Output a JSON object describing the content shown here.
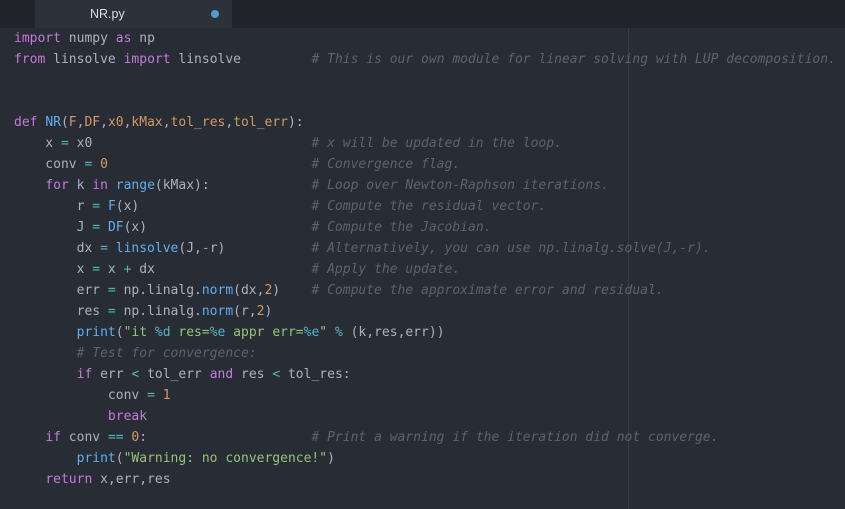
{
  "tab": {
    "title": "NR.py",
    "modified_indicator": "modified-dot"
  },
  "colors": {
    "background": "#282c34",
    "tab_bar": "#21252b",
    "tab_active": "#2c313a",
    "text": "#abb2bf",
    "keyword": "#c678dd",
    "function": "#61afef",
    "string": "#98c379",
    "comment": "#5c6370",
    "number": "#d19a66",
    "operator": "#56b6c2",
    "param": "#d19a66",
    "modified_dot": "#529cca",
    "ruler": "#383e49"
  },
  "editor": {
    "lines": [
      [
        [
          "import",
          "kw"
        ],
        [
          " numpy ",
          "txt"
        ],
        [
          "as",
          "kw"
        ],
        [
          " np",
          "txt"
        ]
      ],
      [
        [
          "from",
          "kw"
        ],
        [
          " linsolve ",
          "txt"
        ],
        [
          "import",
          "kw"
        ],
        [
          " linsolve",
          "txt"
        ],
        [
          "         ",
          "txt"
        ],
        [
          "# This is our own module for linear solving with LUP decomposition.",
          "cmt"
        ]
      ],
      [],
      [],
      [
        [
          "def",
          "kw"
        ],
        [
          " ",
          "txt"
        ],
        [
          "NR",
          "fn"
        ],
        [
          "(",
          "txt"
        ],
        [
          "F",
          "param"
        ],
        [
          ",",
          "txt"
        ],
        [
          "DF",
          "param"
        ],
        [
          ",",
          "txt"
        ],
        [
          "x0",
          "param"
        ],
        [
          ",",
          "txt"
        ],
        [
          "kMax",
          "param"
        ],
        [
          ",",
          "txt"
        ],
        [
          "tol_res",
          "param"
        ],
        [
          ",",
          "txt"
        ],
        [
          "tol_err",
          "param"
        ],
        [
          "):",
          "txt"
        ]
      ],
      [
        [
          "    x ",
          "txt"
        ],
        [
          "=",
          "op"
        ],
        [
          " x0",
          "txt"
        ],
        [
          "                            ",
          "txt"
        ],
        [
          "# x will be updated in the loop.",
          "cmt"
        ]
      ],
      [
        [
          "    conv ",
          "txt"
        ],
        [
          "=",
          "op"
        ],
        [
          " ",
          "txt"
        ],
        [
          "0",
          "num"
        ],
        [
          "                          ",
          "txt"
        ],
        [
          "# Convergence flag.",
          "cmt"
        ]
      ],
      [
        [
          "    ",
          "txt"
        ],
        [
          "for",
          "kw"
        ],
        [
          " k ",
          "txt"
        ],
        [
          "in",
          "kw"
        ],
        [
          " ",
          "txt"
        ],
        [
          "range",
          "fn"
        ],
        [
          "(kMax):",
          "txt"
        ],
        [
          "             ",
          "txt"
        ],
        [
          "# Loop over Newton-Raphson iterations.",
          "cmt"
        ]
      ],
      [
        [
          "        r ",
          "txt"
        ],
        [
          "=",
          "op"
        ],
        [
          " ",
          "txt"
        ],
        [
          "F",
          "fn"
        ],
        [
          "(x)",
          "txt"
        ],
        [
          "                      ",
          "txt"
        ],
        [
          "# Compute the residual vector.",
          "cmt"
        ]
      ],
      [
        [
          "        J ",
          "txt"
        ],
        [
          "=",
          "op"
        ],
        [
          " ",
          "txt"
        ],
        [
          "DF",
          "fn"
        ],
        [
          "(x)",
          "txt"
        ],
        [
          "                     ",
          "txt"
        ],
        [
          "# Compute the Jacobian.",
          "cmt"
        ]
      ],
      [
        [
          "        dx ",
          "txt"
        ],
        [
          "=",
          "op"
        ],
        [
          " ",
          "txt"
        ],
        [
          "linsolve",
          "fn"
        ],
        [
          "(J,",
          "txt"
        ],
        [
          "-",
          "op"
        ],
        [
          "r)",
          "txt"
        ],
        [
          "           ",
          "txt"
        ],
        [
          "# Alternatively, you can use np.linalg.solve(J,-r).",
          "cmt"
        ]
      ],
      [
        [
          "        x ",
          "txt"
        ],
        [
          "=",
          "op"
        ],
        [
          " x ",
          "txt"
        ],
        [
          "+",
          "op"
        ],
        [
          " dx",
          "txt"
        ],
        [
          "                    ",
          "txt"
        ],
        [
          "# Apply the update.",
          "cmt"
        ]
      ],
      [
        [
          "        err ",
          "txt"
        ],
        [
          "=",
          "op"
        ],
        [
          " np.linalg.",
          "txt"
        ],
        [
          "norm",
          "fn"
        ],
        [
          "(dx,",
          "txt"
        ],
        [
          "2",
          "num"
        ],
        [
          ")",
          "txt"
        ],
        [
          "    ",
          "txt"
        ],
        [
          "# Compute the approximate error and residual.",
          "cmt"
        ]
      ],
      [
        [
          "        res ",
          "txt"
        ],
        [
          "=",
          "op"
        ],
        [
          " np.linalg.",
          "txt"
        ],
        [
          "norm",
          "fn"
        ],
        [
          "(r,",
          "txt"
        ],
        [
          "2",
          "num"
        ],
        [
          ")",
          "txt"
        ]
      ],
      [
        [
          "        ",
          "txt"
        ],
        [
          "print",
          "fn"
        ],
        [
          "(",
          "txt"
        ],
        [
          "\"it ",
          "str"
        ],
        [
          "%d",
          "fmt"
        ],
        [
          " res=",
          "str"
        ],
        [
          "%e",
          "fmt"
        ],
        [
          " appr err=",
          "str"
        ],
        [
          "%e",
          "fmt"
        ],
        [
          "\"",
          "str"
        ],
        [
          " ",
          "txt"
        ],
        [
          "%",
          "op"
        ],
        [
          " (k,res,err))",
          "txt"
        ]
      ],
      [
        [
          "        ",
          "txt"
        ],
        [
          "# Test for convergence:",
          "cmt"
        ]
      ],
      [
        [
          "        ",
          "txt"
        ],
        [
          "if",
          "kw"
        ],
        [
          " err ",
          "txt"
        ],
        [
          "<",
          "op"
        ],
        [
          " tol_err ",
          "txt"
        ],
        [
          "and",
          "kw"
        ],
        [
          " res ",
          "txt"
        ],
        [
          "<",
          "op"
        ],
        [
          " tol_res:",
          "txt"
        ]
      ],
      [
        [
          "            conv ",
          "txt"
        ],
        [
          "=",
          "op"
        ],
        [
          " ",
          "txt"
        ],
        [
          "1",
          "num"
        ]
      ],
      [
        [
          "            ",
          "txt"
        ],
        [
          "break",
          "kw"
        ]
      ],
      [
        [
          "    ",
          "txt"
        ],
        [
          "if",
          "kw"
        ],
        [
          " conv ",
          "txt"
        ],
        [
          "==",
          "op"
        ],
        [
          " ",
          "txt"
        ],
        [
          "0",
          "num"
        ],
        [
          ":",
          "txt"
        ],
        [
          "                     ",
          "txt"
        ],
        [
          "# Print a warning if the iteration did not converge.",
          "cmt"
        ]
      ],
      [
        [
          "        ",
          "txt"
        ],
        [
          "print",
          "fn"
        ],
        [
          "(",
          "txt"
        ],
        [
          "\"Warning: no convergence!\"",
          "str"
        ],
        [
          ")",
          "txt"
        ]
      ],
      [
        [
          "    ",
          "txt"
        ],
        [
          "return",
          "kw"
        ],
        [
          " x,err,res",
          "txt"
        ]
      ]
    ]
  }
}
